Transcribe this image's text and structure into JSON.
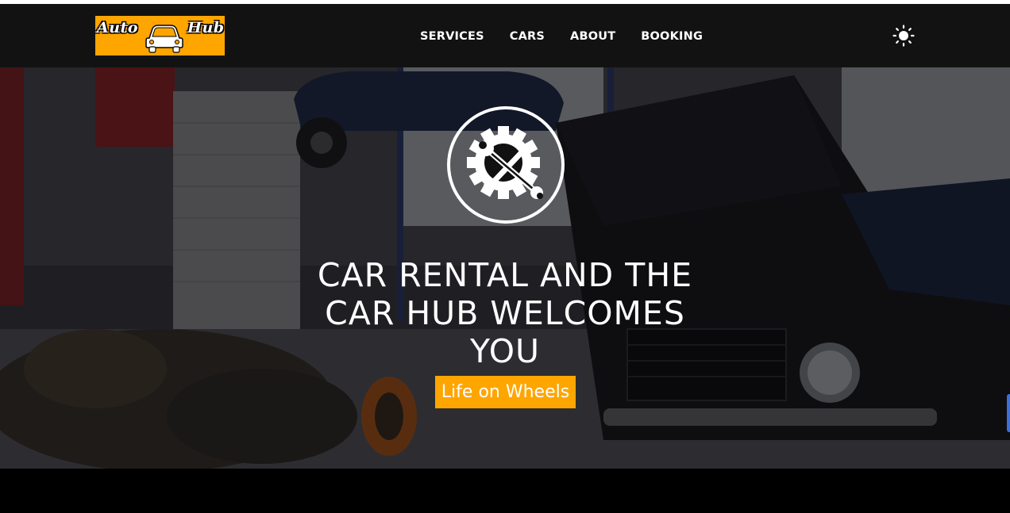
{
  "brand": {
    "logo_text_first": "Auto",
    "logo_text_second": "Hub",
    "logo_background": "#ffa500",
    "logo_icon": "car-icon"
  },
  "nav": {
    "items": [
      {
        "label": "SERVICES"
      },
      {
        "label": "CARS"
      },
      {
        "label": "ABOUT"
      },
      {
        "label": "BOOKING"
      }
    ],
    "theme_toggle_icon": "sun-icon"
  },
  "hero": {
    "emblem_icon": "gear-wrench-icon",
    "title_lines": [
      "CAR RENTAL AND THE",
      "CAR HUB WELCOMES",
      "YOU"
    ],
    "tagline": "Life on Wheels",
    "background_image": "garage-workshop-with-cars-on-lifts"
  },
  "colors": {
    "accent": "#ffa500",
    "navbar": "#121212",
    "text": "#ffffff"
  }
}
